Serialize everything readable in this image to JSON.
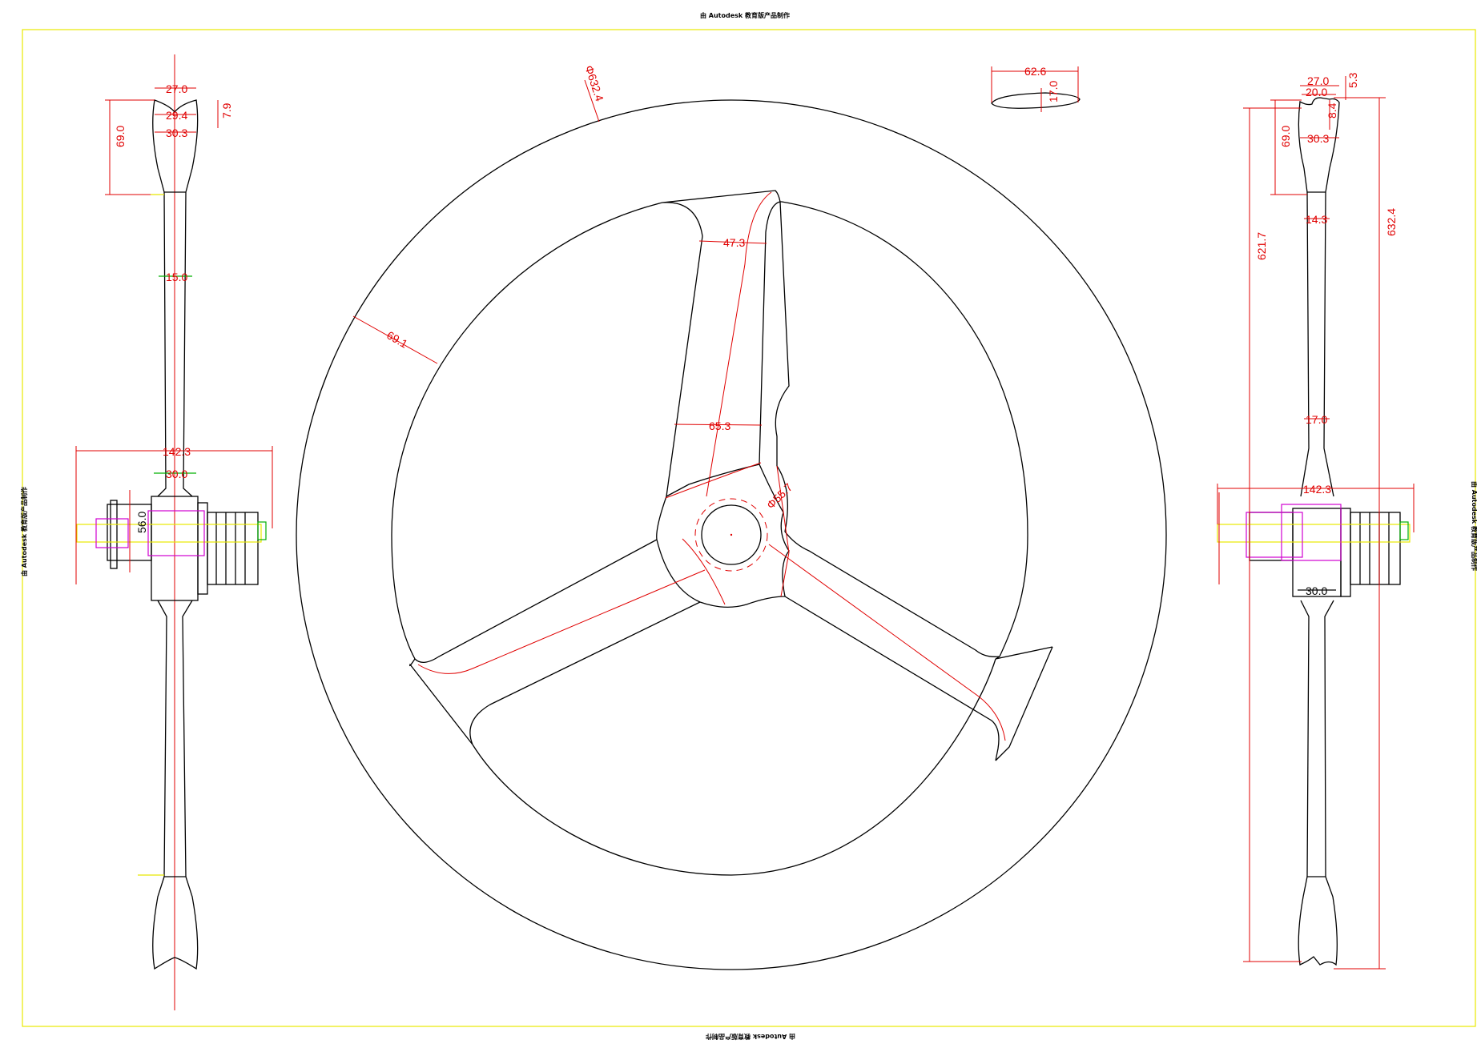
{
  "stamps": {
    "top": "由 Autodesk 教育版产品制作",
    "bottom": "由 Autodesk 教育版产品制作",
    "left": "由 Autodesk 教育版产品制作",
    "right": "由 Autodesk 教育版产品制作"
  },
  "front_view": {
    "outer_diameter": "Φ632.4",
    "rim_depth": "69.1",
    "spoke_width_outer": "47.3",
    "spoke_width_inner": "65.3",
    "hub_diameter": "Φ55.7"
  },
  "profile_section": {
    "width": "62.6",
    "thickness": "17.0"
  },
  "left_view": {
    "rim_width_top": "27.0",
    "rim_width_mid": "29.4",
    "rim_width_max": "30.3",
    "rim_lip": "7.9",
    "rim_depth": "69.0",
    "spoke_thickness": "15.0",
    "hub_width": "142.3",
    "hub_flange": "30.0",
    "hub_height": "56.0"
  },
  "right_view": {
    "rim_width_top": "27.0",
    "rim_inner": "20.0",
    "rim_lip": "5.3",
    "rim_hook": "8.4",
    "rim_width_max": "30.3",
    "rim_depth": "69.0",
    "spoke_top": "14.3",
    "spoke_bottom": "17.0",
    "inner_height": "621.7",
    "outer_height": "632.4",
    "hub_width": "142.3",
    "hub_body": "30.0"
  },
  "colors": {
    "outline": "#000000",
    "dimension": "#e00000",
    "frame": "#e8e800",
    "hub_detail": "#d000d0",
    "marker": "#00b000"
  }
}
